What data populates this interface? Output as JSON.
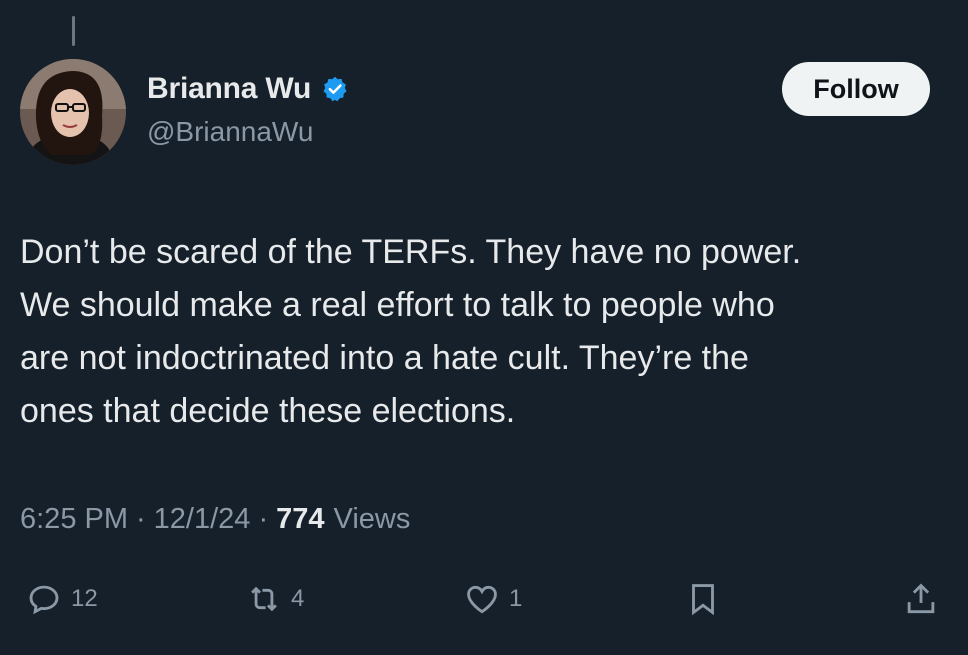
{
  "author": {
    "display_name": "Brianna Wu",
    "handle": "@BriannaWu",
    "verified": true,
    "verified_color": "#1d9bf0"
  },
  "follow_label": "Follow",
  "tweet": {
    "lines": [
      "Don’t be scared of the TERFs. They have no power.",
      "We should make a real effort to talk to people who",
      "are not indoctrinated into a hate cult. They’re the",
      "ones that decide these elections."
    ]
  },
  "meta": {
    "time": "6:25 PM",
    "separator": "·",
    "date": "12/1/24",
    "views_count": "774",
    "views_label": "Views"
  },
  "actions": {
    "replies": "12",
    "retweets": "4",
    "likes": "1"
  },
  "icons": {
    "reply": "reply-icon",
    "retweet": "retweet-icon",
    "like": "heart-icon",
    "bookmark": "bookmark-icon",
    "share": "share-icon"
  },
  "colors": {
    "background": "#15202b",
    "text": "#e7e9ea",
    "muted": "#8b98a5",
    "accent": "#1d9bf0"
  }
}
